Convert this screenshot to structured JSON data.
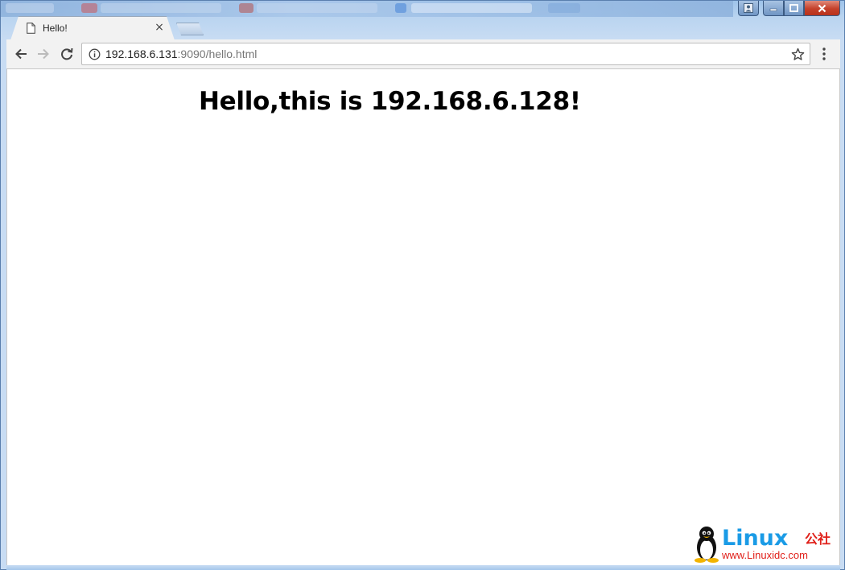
{
  "browser": {
    "tab": {
      "title": "Hello!",
      "close_glyph": "×",
      "favicon": "page-icon"
    },
    "toolbar": {
      "back_icon": "arrow-left-icon",
      "forward_icon": "arrow-right-icon",
      "reload_icon": "reload-icon",
      "url_host": "192.168.6.131",
      "url_rest": ":9090/hello.html",
      "info_icon": "info-icon",
      "bookmark_icon": "star-icon",
      "menu_icon": "vertical-dots-icon"
    },
    "window_controls": {
      "user_icon": "user-icon",
      "minimize_icon": "minimize-icon",
      "maximize_icon": "maximize-icon",
      "close_icon": "close-icon"
    }
  },
  "page": {
    "heading": "Hello,this is 192.168.6.128!"
  },
  "watermark": {
    "brand": "Linux",
    "brand_suffix": "公社",
    "url": "www.Linuxidc.com"
  },
  "colors": {
    "title_bar": "#9ec3ea",
    "close_button": "#c4402a",
    "watermark_blue": "#1a9be6",
    "watermark_red": "#e0201a"
  }
}
